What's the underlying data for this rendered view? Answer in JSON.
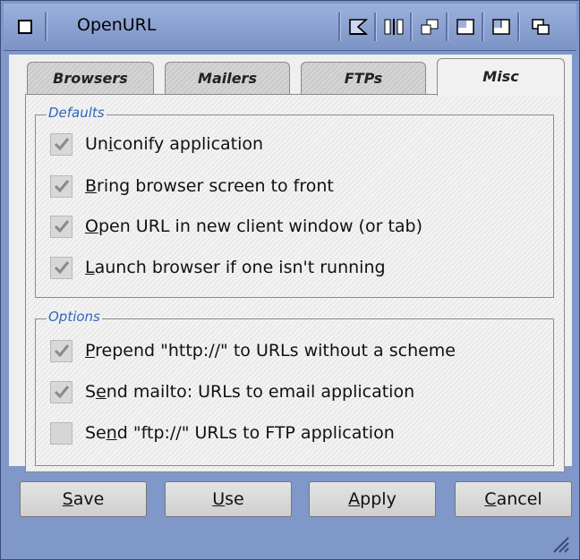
{
  "window": {
    "title": "OpenURL",
    "icons": [
      "close-icon",
      "iconify-icon",
      "jump-icon",
      "snapshot-icon",
      "zoom-icon",
      "fullscreen-icon",
      "depth-icon"
    ]
  },
  "tabs": [
    {
      "label": "Browsers",
      "active": false
    },
    {
      "label": "Mailers",
      "active": false
    },
    {
      "label": "FTPs",
      "active": false
    },
    {
      "label": "Misc",
      "active": true
    }
  ],
  "defaults": {
    "title": "Defaults",
    "items": [
      {
        "pre": "Un",
        "key": "i",
        "post": "conify application",
        "checked": true
      },
      {
        "pre": "",
        "key": "B",
        "post": "ring browser screen to front",
        "checked": true
      },
      {
        "pre": "",
        "key": "O",
        "post": "pen URL in new client window (or tab)",
        "checked": true
      },
      {
        "pre": "",
        "key": "L",
        "post": "aunch browser if one isn't running",
        "checked": true
      }
    ]
  },
  "options": {
    "title": "Options",
    "items": [
      {
        "pre": "",
        "key": "P",
        "post": "repend \"http://\" to URLs without a scheme",
        "checked": true
      },
      {
        "pre": "S",
        "key": "e",
        "post": "nd mailto: URLs to email application",
        "checked": true
      },
      {
        "pre": "Se",
        "key": "n",
        "post": "d \"ftp://\" URLs to FTP application",
        "checked": false
      }
    ]
  },
  "buttons": {
    "save": {
      "key": "S",
      "rest": "ave"
    },
    "use": {
      "key": "U",
      "rest": "se"
    },
    "apply": {
      "key": "A",
      "rest": "pply"
    },
    "cancel": {
      "key": "C",
      "rest": "ancel"
    }
  }
}
